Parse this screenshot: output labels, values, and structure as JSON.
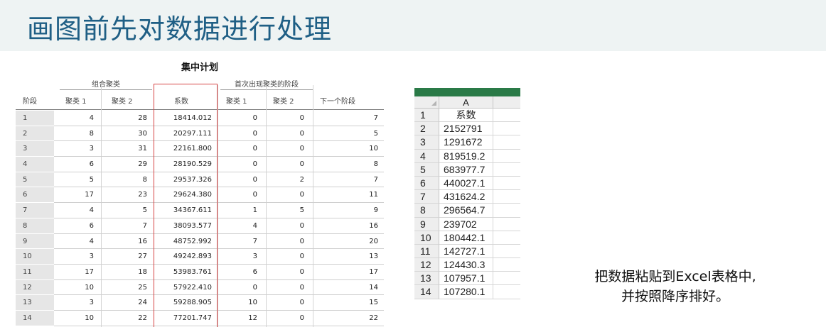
{
  "slide": {
    "title": "画图前先对数据进行处理",
    "caption_line1": "把数据粘贴到Excel表格中,",
    "caption_line2": "并按照降序排好。"
  },
  "spss": {
    "title": "集中计划",
    "group_combined": "组合聚类",
    "group_first_appear": "首次出现聚类的阶段",
    "headers": [
      "阶段",
      "聚类 1",
      "聚类 2",
      "系数",
      "聚类 1",
      "聚类 2",
      "下一个阶段"
    ],
    "rows": [
      [
        "1",
        "4",
        "28",
        "18414.012",
        "0",
        "0",
        "7"
      ],
      [
        "2",
        "8",
        "30",
        "20297.111",
        "0",
        "0",
        "5"
      ],
      [
        "3",
        "3",
        "31",
        "22161.800",
        "0",
        "0",
        "10"
      ],
      [
        "4",
        "6",
        "29",
        "28190.529",
        "0",
        "0",
        "8"
      ],
      [
        "5",
        "5",
        "8",
        "29537.326",
        "0",
        "2",
        "7"
      ],
      [
        "6",
        "17",
        "23",
        "29624.380",
        "0",
        "0",
        "11"
      ],
      [
        "7",
        "4",
        "5",
        "34367.611",
        "1",
        "5",
        "9"
      ],
      [
        "8",
        "6",
        "7",
        "38093.577",
        "4",
        "0",
        "16"
      ],
      [
        "9",
        "4",
        "16",
        "48752.992",
        "7",
        "0",
        "20"
      ],
      [
        "10",
        "3",
        "27",
        "49242.893",
        "3",
        "0",
        "13"
      ],
      [
        "11",
        "17",
        "18",
        "53983.761",
        "6",
        "0",
        "17"
      ],
      [
        "12",
        "10",
        "25",
        "57922.410",
        "0",
        "0",
        "14"
      ],
      [
        "13",
        "3",
        "24",
        "59288.905",
        "10",
        "0",
        "15"
      ],
      [
        "14",
        "10",
        "22",
        "77201.747",
        "12",
        "0",
        "22"
      ]
    ]
  },
  "excel": {
    "column_header": "A",
    "rows": [
      {
        "n": "1",
        "v": "系数"
      },
      {
        "n": "2",
        "v": "2152791"
      },
      {
        "n": "3",
        "v": "1291672"
      },
      {
        "n": "4",
        "v": "819519.2"
      },
      {
        "n": "5",
        "v": "683977.7"
      },
      {
        "n": "6",
        "v": "440027.1"
      },
      {
        "n": "7",
        "v": "431624.2"
      },
      {
        "n": "8",
        "v": "296564.7"
      },
      {
        "n": "9",
        "v": "239702"
      },
      {
        "n": "10",
        "v": "180442.1"
      },
      {
        "n": "11",
        "v": "142727.1"
      },
      {
        "n": "12",
        "v": "124430.3"
      },
      {
        "n": "13",
        "v": "107957.1"
      },
      {
        "n": "14",
        "v": "107280.1"
      }
    ]
  },
  "colors": {
    "title": "#1f5f85",
    "title_band": "#eef3f3",
    "highlight_box": "#d64545",
    "excel_ribbon": "#2a7a47"
  }
}
